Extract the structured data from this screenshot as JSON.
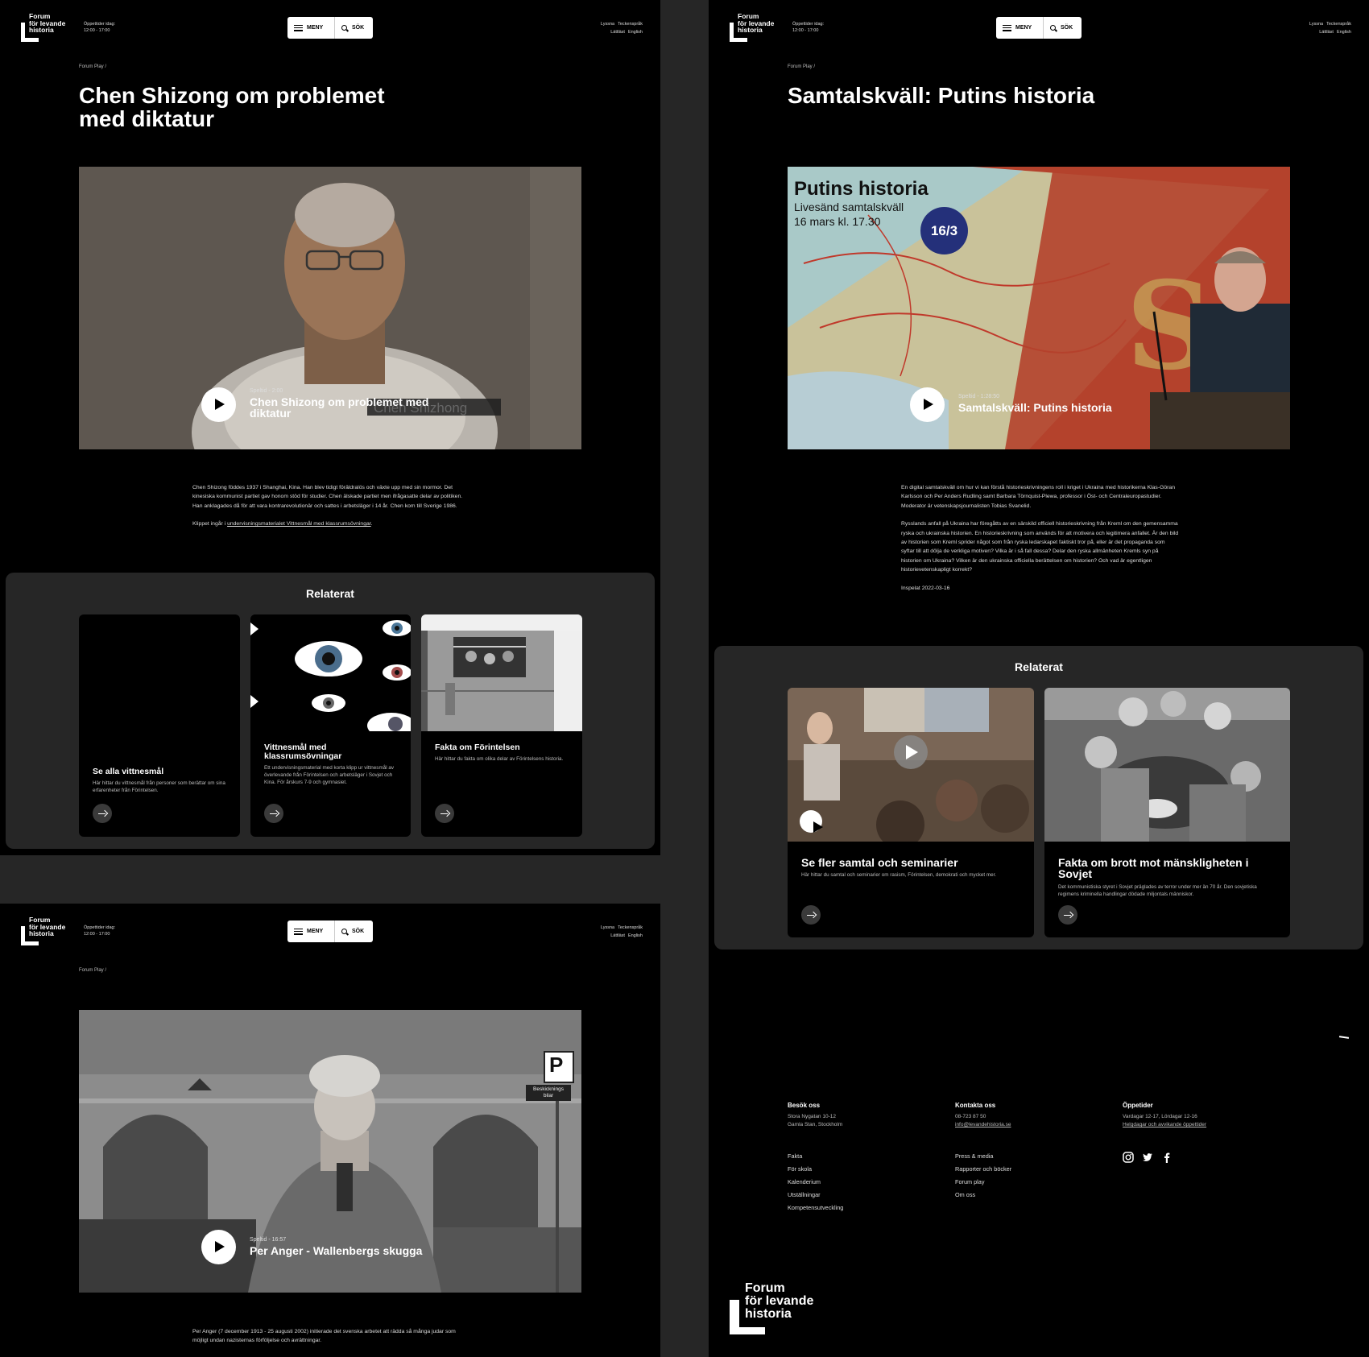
{
  "header": {
    "logo_lines": [
      "Forum",
      "för levande",
      "historia"
    ],
    "hours_label": "Öppettider idag:",
    "hours_value": "12:00 - 17:00",
    "menu_label": "MENY",
    "search_label": "SÖK",
    "lang_row1": [
      "Lyssna",
      "Teckenspråk"
    ],
    "lang_row2": [
      "Lättläst",
      "English"
    ]
  },
  "page1": {
    "breadcrumb": "Forum Play /",
    "title": "Chen Shizong om problemet med diktatur",
    "video_time": "Speltid - 2:00",
    "video_title": "Chen Shizong om problemet med diktatur",
    "video_caption_overlay": "Chen Shizhong",
    "body_p1": "Chen Shizong föddes 1937 i Shanghai, Kina. Han blev tidigt föräldralös och växte upp med sin mormor. Det kinesiska kommunist partiet gav honom stöd för studier. Chen älskade partiet men ifrågasatte delar av politiken. Han anklagades då för att vara kontrarevolutionär och sattes i arbetsläger i 14 år. Chen kom till Sverige 1986.",
    "body_p2_prefix": "Klippet ingår i ",
    "body_p2_link": "undervisningsmaterialet Vittnesmål med klassrumsövningar",
    "body_p2_suffix": ".",
    "related_heading": "Relaterat",
    "cards": [
      {
        "title": "Se alla vittnesmål",
        "desc": "Här hittar du vittnesmål från personer som berättar om sina erfarenheter från Förintelsen."
      },
      {
        "title": "Vittnesmål med klassrumsövningar",
        "desc": "Ett undervisningsmaterial med korta klipp ur vittnesmål av överlevande från Förintelsen och arbetsläger i Sovjet och Kina. För årskurs 7-9 och gymnasiet."
      },
      {
        "title": "Fakta om Förintelsen",
        "desc": "Här hittar du fakta om olika delar av Förintelsens historia."
      }
    ]
  },
  "page2": {
    "breadcrumb": "Forum Play /",
    "title": "Samtalskväll: Putins historia",
    "poster_title": "Putins historia",
    "poster_sub1": "Livesänd samtalskväll",
    "poster_sub2": "16 mars kl. 17.30",
    "poster_badge": "16/3",
    "video_time": "Speltid - 1:28:50",
    "video_title": "Samtalskväll: Putins historia",
    "body_p1": "En digital samtalskväll om hur vi kan förstå historieskrivningens roll i kriget i Ukraina med historikerna Klas-Göran Karlsson och Per Anders Rudling samt Barbara Törnquist-Plewa, professor i Öst- och Centraleuropastudier. Moderator är vetenskapsjournalisten Tobias Svanelid.",
    "body_p2": "Rysslands anfall på Ukraina har föregåtts av en särskild officiell historieskrivning från Kreml om den gemensamma ryska och ukrainska historien. En historieskrivning som används för att motivera och legitimera anfallet. Är den bild av historien som Kreml sprider något som från ryska ledarskapet faktiskt tror på, eller är det propaganda som syftar till att dölja de verkliga motiven? Vilka är i så fall dessa? Delar den ryska allmänheten Kremls syn på historien om Ukraina? Vilken är den ukrainska officiella berättelsen om historien? Och vad är egentligen historievetenskapligt korrekt?",
    "recorded": "Inspelat 2022-03-16",
    "related_heading": "Relaterat",
    "cards": [
      {
        "title": "Se fler samtal och seminarier",
        "desc": "Här hittar du samtal och seminarier om rasism, Förintelsen, demokrati och mycket mer."
      },
      {
        "title": "Fakta om brott mot mänskligheten i Sovjet",
        "desc": "Det kommunistiska styret i Sovjet präglades av terror under mer än 70 år. Den sovjetiska regimens kriminella handlingar dödade miljontals människor."
      }
    ]
  },
  "page3": {
    "breadcrumb": "Forum Play /",
    "sign_letter": "P",
    "sign_text": "Beskicknings bilar",
    "video_time": "Speltid - 16:57",
    "video_title": "Per Anger - Wallenbergs skugga",
    "body_p1": "Per Anger (7 december 1913 - 25 augusti 2002) initierade det svenska arbetet att rädda så många judar som möjligt undan nazisternas förföljelse och avrättningar."
  },
  "footer": {
    "visit_heading": "Besök oss",
    "visit_lines": [
      "Stora Nygatan 10-12",
      "Gamla Stan, Stockholm"
    ],
    "contact_heading": "Kontakta oss",
    "contact_phone": "08-723 87 50",
    "contact_email": "info@levandehistoria.se",
    "hours_heading": "Öppetider",
    "hours_line": "Vardagar 12-17, Lördagar 12-16",
    "hours_link": "Helgdagar och avvikande öppettider",
    "links_col1": [
      "Fakta",
      "För skola",
      "Kalenderium",
      "Utställningar",
      "Kompetensutveckling"
    ],
    "links_col2": [
      "Press & media",
      "Rapporter och böcker",
      "Forum play",
      "Om oss"
    ],
    "social_icons": [
      "instagram-icon",
      "twitter-icon",
      "facebook-icon"
    ],
    "logo_lines": [
      "Forum",
      "för levande",
      "historia"
    ]
  }
}
